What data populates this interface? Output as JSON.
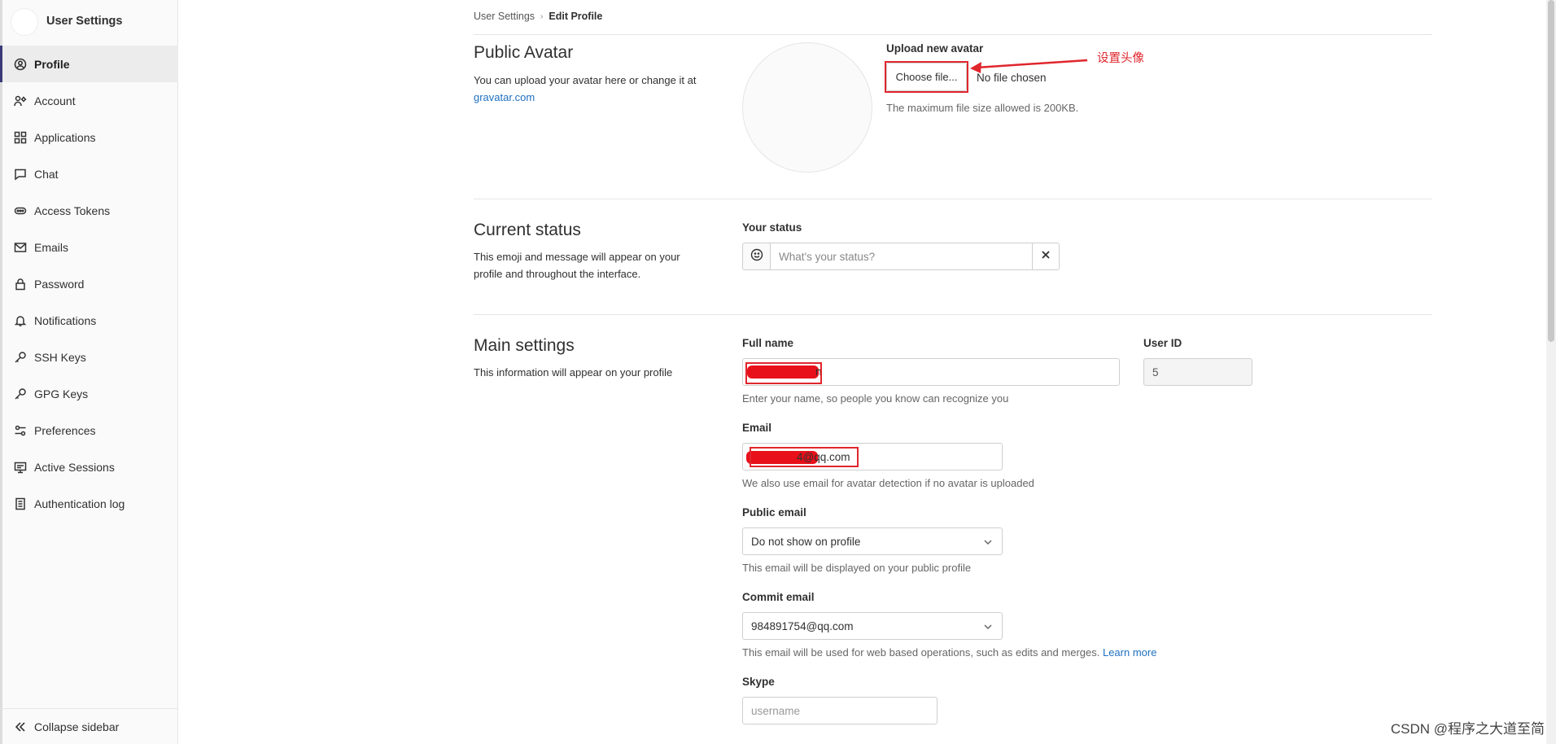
{
  "sidebar": {
    "title": "User Settings",
    "items": [
      {
        "label": "Profile",
        "icon": "profile-icon",
        "active": true
      },
      {
        "label": "Account",
        "icon": "account-icon"
      },
      {
        "label": "Applications",
        "icon": "applications-icon"
      },
      {
        "label": "Chat",
        "icon": "chat-icon"
      },
      {
        "label": "Access Tokens",
        "icon": "token-icon"
      },
      {
        "label": "Emails",
        "icon": "mail-icon"
      },
      {
        "label": "Password",
        "icon": "lock-icon"
      },
      {
        "label": "Notifications",
        "icon": "bell-icon"
      },
      {
        "label": "SSH Keys",
        "icon": "key-icon"
      },
      {
        "label": "GPG Keys",
        "icon": "key-icon"
      },
      {
        "label": "Preferences",
        "icon": "preferences-icon"
      },
      {
        "label": "Active Sessions",
        "icon": "monitor-icon"
      },
      {
        "label": "Authentication log",
        "icon": "log-icon"
      }
    ],
    "collapse_label": "Collapse sidebar"
  },
  "breadcrumb": {
    "parent": "User Settings",
    "current": "Edit Profile"
  },
  "avatar": {
    "title": "Public Avatar",
    "desc": "You can upload your avatar here or change it at",
    "link": "gravatar.com",
    "upload_label": "Upload new avatar",
    "choose_btn": "Choose file...",
    "no_file": "No file chosen",
    "max_size_help": "The maximum file size allowed is 200KB.",
    "annotation": "设置头像"
  },
  "status": {
    "title": "Current status",
    "desc": "This emoji and message will appear on your profile and throughout the interface.",
    "label": "Your status",
    "placeholder": "What's your status?"
  },
  "main_settings": {
    "title": "Main settings",
    "desc": "This information will appear on your profile",
    "full_name_label": "Full name",
    "full_name_visible": "n",
    "full_name_help": "Enter your name, so people you know can recognize you",
    "user_id_label": "User ID",
    "user_id_value": "5",
    "email_label": "Email",
    "email_visible": "4@qq.com",
    "email_help": "We also use email for avatar detection if no avatar is uploaded",
    "public_email_label": "Public email",
    "public_email_value": "Do not show on profile",
    "public_email_help": "This email will be displayed on your public profile",
    "commit_email_label": "Commit email",
    "commit_email_value": "984891754@qq.com",
    "commit_email_help": "This email will be used for web based operations, such as edits and merges.",
    "learn_more": "Learn more",
    "skype_label": "Skype",
    "skype_placeholder": "username"
  },
  "watermark": "CSDN @程序之大道至简",
  "colors": {
    "accent_link": "#1f70c1",
    "annotation_red": "#e0262d",
    "active_bar": "#3a3a78"
  }
}
